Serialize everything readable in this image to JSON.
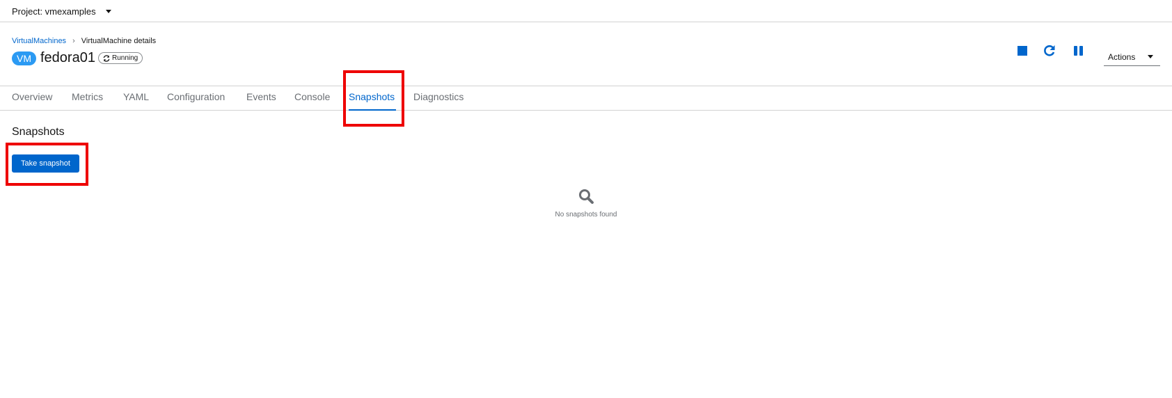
{
  "project": {
    "label": "Project: vmexamples"
  },
  "breadcrumb": {
    "parent": "VirtualMachines",
    "current": "VirtualMachine details"
  },
  "vm": {
    "badge": "VM",
    "name": "fedora01",
    "status": "Running"
  },
  "controls": {
    "stop_icon": "stop-icon",
    "restart_icon": "restart-icon",
    "pause_icon": "pause-icon",
    "actions_label": "Actions"
  },
  "tabs": [
    {
      "label": "Overview",
      "active": false
    },
    {
      "label": "Metrics",
      "active": false
    },
    {
      "label": "YAML",
      "active": false
    },
    {
      "label": "Configuration",
      "active": false
    },
    {
      "label": "Events",
      "active": false
    },
    {
      "label": "Console",
      "active": false
    },
    {
      "label": "Snapshots",
      "active": true
    },
    {
      "label": "Diagnostics",
      "active": false
    }
  ],
  "snapshots": {
    "title": "Snapshots",
    "take_button": "Take snapshot",
    "empty_icon": "search-icon",
    "empty_text": "No snapshots found"
  },
  "colors": {
    "accent": "#0066cc",
    "badge": "#2b9af3",
    "highlight": "#ee0000"
  }
}
